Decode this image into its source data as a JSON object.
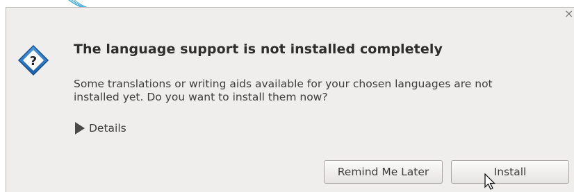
{
  "dialog": {
    "close_label": "×",
    "title": "The language support is not installed completely",
    "message": "Some translations or writing aids available for your chosen languages are not\ninstalled yet. Do you want to install them now?",
    "details_label": "Details",
    "icon": "question-icon",
    "buttons": {
      "remind_label": "Remind Me Later",
      "install_label": "Install"
    }
  },
  "colors": {
    "dialog_bg": "#efeeed",
    "icon_blue": "#1e6fb8",
    "title_text": "#2e2e2e"
  }
}
